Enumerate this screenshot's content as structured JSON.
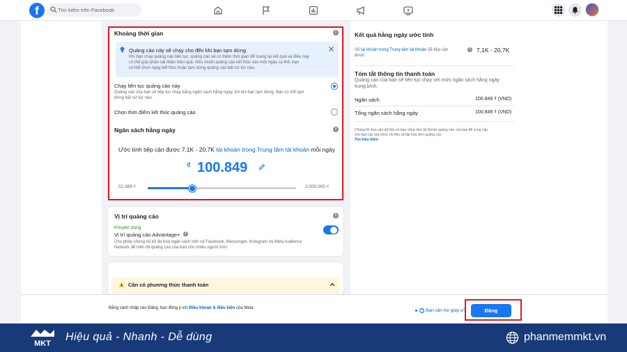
{
  "topbar": {
    "search_placeholder": "Tìm kiếm trên Facebook"
  },
  "schedule_card": {
    "title": "Khoảng thời gian",
    "notice_title": "Quảng cáo này sẽ chạy cho đến khi bạn tạm dừng",
    "notice_body_1": "Khi bạn chạy quảng cáo liên tục, quảng cáo sẽ có thêm thời gian để mang lại kết quả và điều này",
    "notice_body_2": "có thể góp phần cải thiện hiệu quả. Nếu muốn quảng cáo kết thúc vào một ngày cụ thể, bạn",
    "notice_body_3": "có thể chọn ngày kết thúc hoặc tạm dừng quảng cáo bất cứ lúc nào.",
    "option_continuous_label": "Chạy liên tục quảng cáo này",
    "option_continuous_desc_1": "Quảng cáo của bạn sẽ tiếp tục chạy bằng ngân sách hằng ngày, trừ khi bạn tạm dừng. Bạn có thể tạm",
    "option_continuous_desc_2": "dừng bất cứ lúc nào.",
    "option_end_label": "Chọn thời điểm kết thúc quảng cáo"
  },
  "budget": {
    "title": "Ngân sách hằng ngày",
    "reach_prefix": "Ước tính tiếp cận được 7,1K - 20,7K",
    "reach_link": "tài khoản trong Trung tâm tài khoản",
    "reach_suffix": "mỗi ngày",
    "currency_symbol": "₫",
    "amount": "100.849",
    "slider_min": "52.389 ₫",
    "slider_max": "2.000.000 ₫",
    "slider_fraction": 0.3
  },
  "placement": {
    "title": "Vị trí quảng cáo",
    "recommended": "Khuyên dùng",
    "advantage_label": "Vị trí quảng cáo Advantage+",
    "desc_1": "Cho phép chúng tôi tối đa hóa ngân sách trên cả Facebook, Messenger, Instagram và Meta Audience",
    "desc_2": "Network để hiển thị quảng cáo của bạn cho nhiều người hơn."
  },
  "payment": {
    "warning": "Cần có phương thức thanh toán"
  },
  "results": {
    "title": "Kết quả hằng ngày ước tính",
    "reach_prefix": "Số",
    "reach_link": "tài khoản trong Trung tâm tài khoản",
    "reach_suffix": "đã tiếp cận",
    "reach_suffix_2": "được",
    "reach_value": "7,1K - 20,7K"
  },
  "summary": {
    "title": "Tóm tắt thông tin thanh toán",
    "desc_1": "Quảng cáo của bạn sẽ liên tục chạy với mức ngân sách hằng ngày",
    "desc_2": "trung bình.",
    "rows": [
      {
        "label": "Ngân sách",
        "value": "100.849 ₫ (VND)"
      },
      {
        "label": "Tổng ngân sách hằng ngày",
        "value": "100.849 ₫ (VND)"
      }
    ],
    "footnote_1": "Chúng tôi dựa vào dữ liệu về bạn cũng như tài khoản quảng cáo của bạn để cung cấp",
    "footnote_2": "cho bạn các lựa chọn chi tiêu và lập hóa đơn quảng cáo.",
    "learn_more": "Tìm hiểu thêm"
  },
  "footer": {
    "terms_prefix": "Bằng cách nhấp vào Đăng, bạn đồng ý với",
    "terms_link": "Điều khoản & điều kiện",
    "terms_suffix": "của Meta",
    "help": "Bạn cần trợ giúp ư?",
    "submit": "Đăng"
  },
  "banner": {
    "logo_text": "MKT",
    "slogan": "Hiệu quả - Nhanh - Dễ dùng",
    "domain": "phanmemmkt.vn"
  },
  "colors": {
    "accent": "#1877f2",
    "highlight_border": "#e0181c",
    "banner_bg": "#183a78"
  }
}
